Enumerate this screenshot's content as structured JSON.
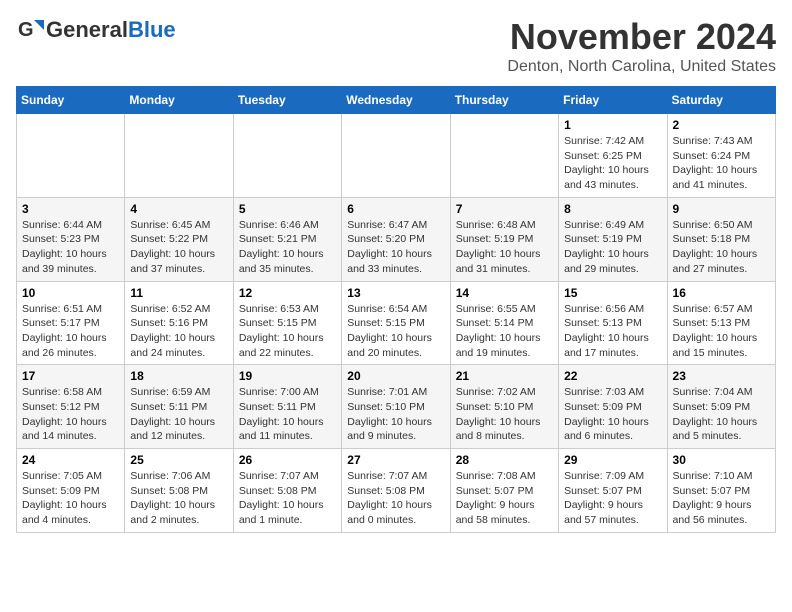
{
  "header": {
    "logo_general": "General",
    "logo_blue": "Blue",
    "month": "November 2024",
    "location": "Denton, North Carolina, United States"
  },
  "days_of_week": [
    "Sunday",
    "Monday",
    "Tuesday",
    "Wednesday",
    "Thursday",
    "Friday",
    "Saturday"
  ],
  "weeks": [
    [
      {
        "day": "",
        "info": ""
      },
      {
        "day": "",
        "info": ""
      },
      {
        "day": "",
        "info": ""
      },
      {
        "day": "",
        "info": ""
      },
      {
        "day": "",
        "info": ""
      },
      {
        "day": "1",
        "info": "Sunrise: 7:42 AM\nSunset: 6:25 PM\nDaylight: 10 hours and 43 minutes."
      },
      {
        "day": "2",
        "info": "Sunrise: 7:43 AM\nSunset: 6:24 PM\nDaylight: 10 hours and 41 minutes."
      }
    ],
    [
      {
        "day": "3",
        "info": "Sunrise: 6:44 AM\nSunset: 5:23 PM\nDaylight: 10 hours and 39 minutes."
      },
      {
        "day": "4",
        "info": "Sunrise: 6:45 AM\nSunset: 5:22 PM\nDaylight: 10 hours and 37 minutes."
      },
      {
        "day": "5",
        "info": "Sunrise: 6:46 AM\nSunset: 5:21 PM\nDaylight: 10 hours and 35 minutes."
      },
      {
        "day": "6",
        "info": "Sunrise: 6:47 AM\nSunset: 5:20 PM\nDaylight: 10 hours and 33 minutes."
      },
      {
        "day": "7",
        "info": "Sunrise: 6:48 AM\nSunset: 5:19 PM\nDaylight: 10 hours and 31 minutes."
      },
      {
        "day": "8",
        "info": "Sunrise: 6:49 AM\nSunset: 5:19 PM\nDaylight: 10 hours and 29 minutes."
      },
      {
        "day": "9",
        "info": "Sunrise: 6:50 AM\nSunset: 5:18 PM\nDaylight: 10 hours and 27 minutes."
      }
    ],
    [
      {
        "day": "10",
        "info": "Sunrise: 6:51 AM\nSunset: 5:17 PM\nDaylight: 10 hours and 26 minutes."
      },
      {
        "day": "11",
        "info": "Sunrise: 6:52 AM\nSunset: 5:16 PM\nDaylight: 10 hours and 24 minutes."
      },
      {
        "day": "12",
        "info": "Sunrise: 6:53 AM\nSunset: 5:15 PM\nDaylight: 10 hours and 22 minutes."
      },
      {
        "day": "13",
        "info": "Sunrise: 6:54 AM\nSunset: 5:15 PM\nDaylight: 10 hours and 20 minutes."
      },
      {
        "day": "14",
        "info": "Sunrise: 6:55 AM\nSunset: 5:14 PM\nDaylight: 10 hours and 19 minutes."
      },
      {
        "day": "15",
        "info": "Sunrise: 6:56 AM\nSunset: 5:13 PM\nDaylight: 10 hours and 17 minutes."
      },
      {
        "day": "16",
        "info": "Sunrise: 6:57 AM\nSunset: 5:13 PM\nDaylight: 10 hours and 15 minutes."
      }
    ],
    [
      {
        "day": "17",
        "info": "Sunrise: 6:58 AM\nSunset: 5:12 PM\nDaylight: 10 hours and 14 minutes."
      },
      {
        "day": "18",
        "info": "Sunrise: 6:59 AM\nSunset: 5:11 PM\nDaylight: 10 hours and 12 minutes."
      },
      {
        "day": "19",
        "info": "Sunrise: 7:00 AM\nSunset: 5:11 PM\nDaylight: 10 hours and 11 minutes."
      },
      {
        "day": "20",
        "info": "Sunrise: 7:01 AM\nSunset: 5:10 PM\nDaylight: 10 hours and 9 minutes."
      },
      {
        "day": "21",
        "info": "Sunrise: 7:02 AM\nSunset: 5:10 PM\nDaylight: 10 hours and 8 minutes."
      },
      {
        "day": "22",
        "info": "Sunrise: 7:03 AM\nSunset: 5:09 PM\nDaylight: 10 hours and 6 minutes."
      },
      {
        "day": "23",
        "info": "Sunrise: 7:04 AM\nSunset: 5:09 PM\nDaylight: 10 hours and 5 minutes."
      }
    ],
    [
      {
        "day": "24",
        "info": "Sunrise: 7:05 AM\nSunset: 5:09 PM\nDaylight: 10 hours and 4 minutes."
      },
      {
        "day": "25",
        "info": "Sunrise: 7:06 AM\nSunset: 5:08 PM\nDaylight: 10 hours and 2 minutes."
      },
      {
        "day": "26",
        "info": "Sunrise: 7:07 AM\nSunset: 5:08 PM\nDaylight: 10 hours and 1 minute."
      },
      {
        "day": "27",
        "info": "Sunrise: 7:07 AM\nSunset: 5:08 PM\nDaylight: 10 hours and 0 minutes."
      },
      {
        "day": "28",
        "info": "Sunrise: 7:08 AM\nSunset: 5:07 PM\nDaylight: 9 hours and 58 minutes."
      },
      {
        "day": "29",
        "info": "Sunrise: 7:09 AM\nSunset: 5:07 PM\nDaylight: 9 hours and 57 minutes."
      },
      {
        "day": "30",
        "info": "Sunrise: 7:10 AM\nSunset: 5:07 PM\nDaylight: 9 hours and 56 minutes."
      }
    ]
  ]
}
